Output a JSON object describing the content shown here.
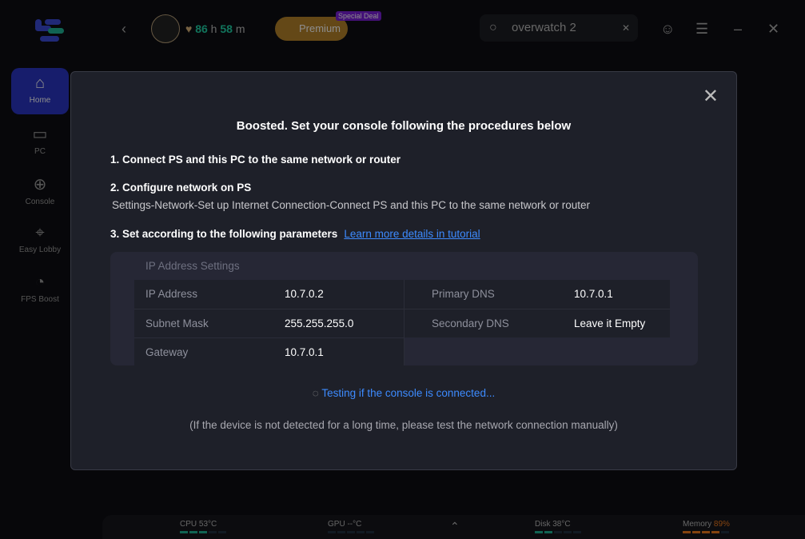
{
  "header": {
    "time_hours": "86",
    "time_h": "h",
    "time_minutes": "58",
    "time_m": "m",
    "premium_label": "Premium",
    "deal_badge": "Special Deal",
    "search_value": "overwatch 2"
  },
  "sidebar": {
    "items": [
      {
        "label": "Home",
        "icon": "home-icon"
      },
      {
        "label": "PC",
        "icon": "monitor-icon"
      },
      {
        "label": "Console",
        "icon": "gamepad-icon"
      },
      {
        "label": "Easy Lobby",
        "icon": "crosshair-icon"
      },
      {
        "label": "FPS Boost",
        "icon": "gauge-icon"
      }
    ]
  },
  "status": {
    "cpu_label": "CPU",
    "cpu_value": "53°C",
    "gpu_label": "GPU",
    "gpu_value": "--°C",
    "disk_label": "Disk",
    "disk_value": "38°C",
    "memory_label": "Memory",
    "memory_value": "89%"
  },
  "modal": {
    "title": "Boosted. Set your console following the procedures below",
    "step1": "1. Connect PS and this PC to the same network or router",
    "step2": "2. Configure network on PS",
    "step2_detail": "Settings-Network-Set up Internet Connection-Connect PS and this PC to the same network or router",
    "step3": "3. Set according to the following parameters",
    "tutorial_link": "Learn more details in tutorial",
    "table_title": "IP Address Settings",
    "rows": [
      {
        "label": "IP Address",
        "value": "10.7.0.2",
        "label2": "Primary DNS",
        "value2": "10.7.0.1"
      },
      {
        "label": "Subnet Mask",
        "value": "255.255.255.0",
        "label2": "Secondary DNS",
        "value2": "Leave it Empty"
      },
      {
        "label": "Gateway",
        "value": "10.7.0.1"
      }
    ],
    "testing": "Testing if the console is connected...",
    "note": "(If the device is not detected for a long time, please test the network connection manually)"
  },
  "colors": {
    "accent": "#3d8bff",
    "brand": "#2a34c4",
    "premium": "#d99a2b",
    "time": "#1fd3a8"
  }
}
